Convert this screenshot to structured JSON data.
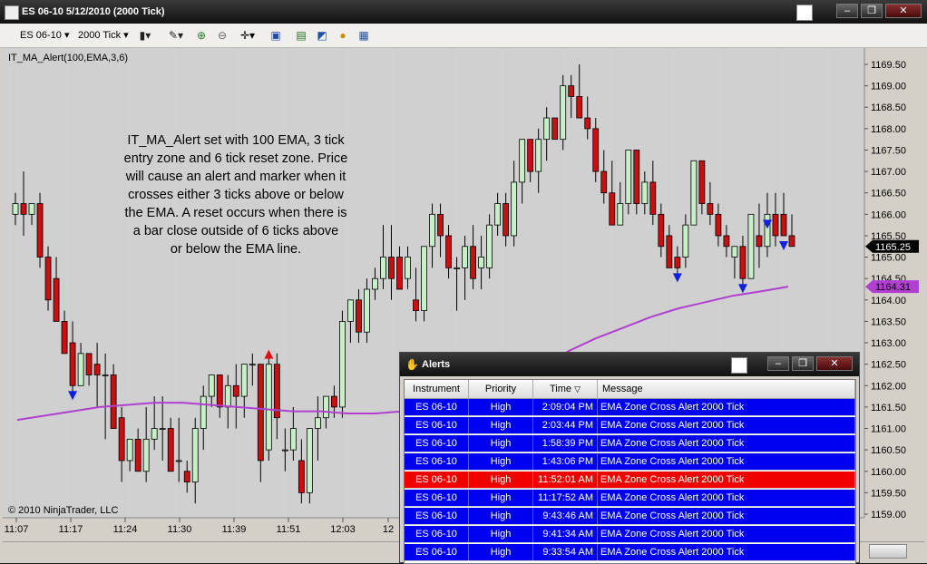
{
  "window": {
    "title": "ES 06-10  5/12/2010 (2000 Tick)",
    "l_button": "L",
    "controls": [
      "minimize-icon",
      "restore-icon",
      "close-icon"
    ]
  },
  "toolbar": {
    "instrument": "ES 06-10",
    "period": "2000 Tick",
    "icons": [
      "bar-chart-icon",
      "pencil-icon",
      "zoom-in-icon",
      "zoom-out-icon",
      "crosshair-icon",
      "properties-icon",
      "data-box-icon",
      "strategy-icon",
      "money-icon",
      "notes-icon"
    ]
  },
  "chart": {
    "indicator_label": "IT_MA_Alert(100,EMA,3,6)",
    "note_lines": [
      "IT_MA_Alert set with 100 EMA, 3 tick",
      "entry zone and 6 tick reset zone. Price",
      "will cause an alert and marker when it",
      "crosses either 3 ticks above or below",
      "the EMA. A reset occurs when there is",
      "a bar close outside of 6 ticks above",
      "or below the EMA line."
    ],
    "copyright": "© 2010 NinjaTrader, LLC",
    "last_price": "1165.25",
    "ema_value": "1164.31",
    "colors": {
      "up": "#c8f0c8",
      "down": "#c81010",
      "ema": "#b040d0",
      "marker_down": "#1020e0",
      "marker_up": "#e01010",
      "bg": "#d4d0c8"
    }
  },
  "chart_data": {
    "type": "candlestick",
    "y_ticks": [
      "1169.50",
      "1169.00",
      "1168.50",
      "1168.00",
      "1167.50",
      "1167.00",
      "1166.50",
      "1166.00",
      "1165.50",
      "1165.00",
      "1164.50",
      "1164.00",
      "1163.50",
      "1163.00",
      "1162.50",
      "1162.00",
      "1161.50",
      "1161.00",
      "1160.50",
      "1160.00",
      "1159.50",
      "1159.00"
    ],
    "ylim": [
      1158.75,
      1169.75
    ],
    "x_ticks": [
      "11:07",
      "11:17",
      "11:24",
      "11:30",
      "11:39",
      "11:51",
      "12:03",
      "12"
    ],
    "candles": [
      {
        "o": 1166.0,
        "h": 1166.5,
        "l": 1165.75,
        "c": 1166.25
      },
      {
        "o": 1166.25,
        "h": 1167.0,
        "l": 1165.5,
        "c": 1166.0
      },
      {
        "o": 1166.0,
        "h": 1166.25,
        "l": 1165.75,
        "c": 1166.25
      },
      {
        "o": 1166.25,
        "h": 1166.5,
        "l": 1164.75,
        "c": 1165.0
      },
      {
        "o": 1165.0,
        "h": 1165.25,
        "l": 1163.75,
        "c": 1164.0
      },
      {
        "o": 1164.5,
        "h": 1165.0,
        "l": 1163.5,
        "c": 1163.5
      },
      {
        "o": 1163.5,
        "h": 1163.75,
        "l": 1162.75,
        "c": 1162.75
      },
      {
        "o": 1163.0,
        "h": 1163.5,
        "l": 1161.75,
        "c": 1162.0
      },
      {
        "o": 1162.0,
        "h": 1163.0,
        "l": 1162.0,
        "c": 1162.75
      },
      {
        "o": 1162.75,
        "h": 1162.75,
        "l": 1162.0,
        "c": 1162.25
      },
      {
        "o": 1162.5,
        "h": 1163.0,
        "l": 1161.5,
        "c": 1162.25
      },
      {
        "o": 1162.25,
        "h": 1162.75,
        "l": 1160.75,
        "c": 1162.25
      },
      {
        "o": 1162.25,
        "h": 1162.5,
        "l": 1161.0,
        "c": 1161.0
      },
      {
        "o": 1161.25,
        "h": 1161.5,
        "l": 1159.75,
        "c": 1160.25
      },
      {
        "o": 1160.25,
        "h": 1160.75,
        "l": 1160.0,
        "c": 1160.75
      },
      {
        "o": 1160.75,
        "h": 1161.0,
        "l": 1160.0,
        "c": 1160.0
      },
      {
        "o": 1160.0,
        "h": 1161.5,
        "l": 1159.75,
        "c": 1160.75
      },
      {
        "o": 1160.75,
        "h": 1161.75,
        "l": 1160.5,
        "c": 1161.0
      },
      {
        "o": 1161.0,
        "h": 1161.75,
        "l": 1160.25,
        "c": 1161.0
      },
      {
        "o": 1161.0,
        "h": 1161.25,
        "l": 1160.0,
        "c": 1160.0
      },
      {
        "o": 1160.25,
        "h": 1161.25,
        "l": 1159.75,
        "c": 1160.25
      },
      {
        "o": 1160.0,
        "h": 1160.25,
        "l": 1159.5,
        "c": 1159.75
      },
      {
        "o": 1159.75,
        "h": 1161.25,
        "l": 1159.25,
        "c": 1161.0
      },
      {
        "o": 1161.0,
        "h": 1162.0,
        "l": 1160.5,
        "c": 1161.75
      },
      {
        "o": 1161.75,
        "h": 1162.25,
        "l": 1161.5,
        "c": 1162.25
      },
      {
        "o": 1162.25,
        "h": 1162.25,
        "l": 1161.25,
        "c": 1161.5
      },
      {
        "o": 1161.5,
        "h": 1162.25,
        "l": 1161.0,
        "c": 1162.0
      },
      {
        "o": 1162.0,
        "h": 1162.5,
        "l": 1161.0,
        "c": 1161.75
      },
      {
        "o": 1161.75,
        "h": 1162.5,
        "l": 1161.25,
        "c": 1162.5
      },
      {
        "o": 1162.5,
        "h": 1162.75,
        "l": 1162.0,
        "c": 1162.5
      },
      {
        "o": 1162.5,
        "h": 1162.5,
        "l": 1159.75,
        "c": 1160.25
      },
      {
        "o": 1160.5,
        "h": 1162.75,
        "l": 1160.25,
        "c": 1162.5
      },
      {
        "o": 1162.5,
        "h": 1162.75,
        "l": 1160.75,
        "c": 1161.25
      },
      {
        "o": 1160.5,
        "h": 1161.0,
        "l": 1160.0,
        "c": 1160.5
      },
      {
        "o": 1160.5,
        "h": 1161.5,
        "l": 1160.25,
        "c": 1161.0
      },
      {
        "o": 1160.25,
        "h": 1160.75,
        "l": 1159.25,
        "c": 1159.5
      },
      {
        "o": 1159.5,
        "h": 1161.0,
        "l": 1159.25,
        "c": 1161.0
      },
      {
        "o": 1161.0,
        "h": 1161.75,
        "l": 1160.25,
        "c": 1161.25
      },
      {
        "o": 1161.25,
        "h": 1161.75,
        "l": 1161.0,
        "c": 1161.75
      },
      {
        "o": 1161.75,
        "h": 1162.0,
        "l": 1161.25,
        "c": 1161.5
      },
      {
        "o": 1161.5,
        "h": 1163.75,
        "l": 1161.25,
        "c": 1163.5
      },
      {
        "o": 1163.5,
        "h": 1164.0,
        "l": 1163.0,
        "c": 1164.0
      },
      {
        "o": 1164.0,
        "h": 1164.25,
        "l": 1163.0,
        "c": 1163.25
      },
      {
        "o": 1163.25,
        "h": 1164.5,
        "l": 1163.0,
        "c": 1164.25
      },
      {
        "o": 1164.25,
        "h": 1164.75,
        "l": 1164.0,
        "c": 1164.5
      },
      {
        "o": 1164.5,
        "h": 1165.75,
        "l": 1164.25,
        "c": 1165.0
      },
      {
        "o": 1165.0,
        "h": 1165.75,
        "l": 1164.0,
        "c": 1164.5
      },
      {
        "o": 1165.0,
        "h": 1165.25,
        "l": 1164.25,
        "c": 1164.25
      },
      {
        "o": 1164.5,
        "h": 1165.25,
        "l": 1164.25,
        "c": 1165.0
      },
      {
        "o": 1164.0,
        "h": 1164.75,
        "l": 1163.5,
        "c": 1163.75
      },
      {
        "o": 1163.75,
        "h": 1165.25,
        "l": 1163.5,
        "c": 1165.25
      },
      {
        "o": 1165.25,
        "h": 1166.25,
        "l": 1164.75,
        "c": 1166.0
      },
      {
        "o": 1166.0,
        "h": 1166.25,
        "l": 1165.0,
        "c": 1165.5
      },
      {
        "o": 1165.5,
        "h": 1165.75,
        "l": 1164.5,
        "c": 1164.75
      },
      {
        "o": 1164.75,
        "h": 1165.0,
        "l": 1163.75,
        "c": 1164.75
      },
      {
        "o": 1164.75,
        "h": 1165.5,
        "l": 1164.0,
        "c": 1165.25
      },
      {
        "o": 1165.25,
        "h": 1165.75,
        "l": 1164.25,
        "c": 1164.5
      },
      {
        "o": 1164.75,
        "h": 1165.5,
        "l": 1164.25,
        "c": 1165.0
      },
      {
        "o": 1164.75,
        "h": 1166.0,
        "l": 1164.5,
        "c": 1165.75
      },
      {
        "o": 1165.75,
        "h": 1166.5,
        "l": 1165.5,
        "c": 1166.25
      },
      {
        "o": 1166.25,
        "h": 1166.5,
        "l": 1165.25,
        "c": 1165.5
      },
      {
        "o": 1165.5,
        "h": 1167.25,
        "l": 1165.25,
        "c": 1166.75
      },
      {
        "o": 1166.75,
        "h": 1167.75,
        "l": 1166.25,
        "c": 1167.75
      },
      {
        "o": 1167.75,
        "h": 1167.75,
        "l": 1166.75,
        "c": 1167.0
      },
      {
        "o": 1167.0,
        "h": 1168.0,
        "l": 1166.5,
        "c": 1167.75
      },
      {
        "o": 1167.75,
        "h": 1168.5,
        "l": 1167.25,
        "c": 1168.25
      },
      {
        "o": 1168.25,
        "h": 1168.25,
        "l": 1167.75,
        "c": 1167.75
      },
      {
        "o": 1167.75,
        "h": 1169.25,
        "l": 1167.5,
        "c": 1169.0
      },
      {
        "o": 1169.0,
        "h": 1169.25,
        "l": 1168.25,
        "c": 1168.75
      },
      {
        "o": 1168.75,
        "h": 1169.5,
        "l": 1168.25,
        "c": 1168.25
      },
      {
        "o": 1168.25,
        "h": 1168.75,
        "l": 1167.75,
        "c": 1168.0
      },
      {
        "o": 1168.0,
        "h": 1168.25,
        "l": 1166.75,
        "c": 1167.0
      },
      {
        "o": 1167.0,
        "h": 1167.5,
        "l": 1166.25,
        "c": 1166.5
      },
      {
        "o": 1166.5,
        "h": 1167.25,
        "l": 1165.75,
        "c": 1165.75
      },
      {
        "o": 1165.75,
        "h": 1166.75,
        "l": 1165.75,
        "c": 1166.25
      },
      {
        "o": 1166.25,
        "h": 1167.5,
        "l": 1166.0,
        "c": 1167.5
      },
      {
        "o": 1167.5,
        "h": 1167.5,
        "l": 1166.0,
        "c": 1166.25
      },
      {
        "o": 1166.25,
        "h": 1167.0,
        "l": 1166.0,
        "c": 1166.75
      },
      {
        "o": 1166.75,
        "h": 1167.25,
        "l": 1165.75,
        "c": 1166.0
      },
      {
        "o": 1166.0,
        "h": 1166.25,
        "l": 1165.0,
        "c": 1165.25
      },
      {
        "o": 1165.5,
        "h": 1165.75,
        "l": 1164.75,
        "c": 1164.75
      },
      {
        "o": 1165.0,
        "h": 1165.25,
        "l": 1164.5,
        "c": 1164.75
      },
      {
        "o": 1165.0,
        "h": 1166.0,
        "l": 1164.75,
        "c": 1165.75
      },
      {
        "o": 1165.75,
        "h": 1167.25,
        "l": 1165.75,
        "c": 1167.25
      },
      {
        "o": 1167.25,
        "h": 1167.25,
        "l": 1166.0,
        "c": 1166.25
      },
      {
        "o": 1166.25,
        "h": 1166.75,
        "l": 1165.75,
        "c": 1166.0
      },
      {
        "o": 1166.0,
        "h": 1166.25,
        "l": 1165.25,
        "c": 1165.5
      },
      {
        "o": 1165.5,
        "h": 1165.75,
        "l": 1165.0,
        "c": 1165.25
      },
      {
        "o": 1165.0,
        "h": 1165.25,
        "l": 1164.5,
        "c": 1165.25
      },
      {
        "o": 1165.25,
        "h": 1165.5,
        "l": 1164.25,
        "c": 1164.5
      },
      {
        "o": 1164.5,
        "h": 1166.0,
        "l": 1164.5,
        "c": 1166.0
      },
      {
        "o": 1165.5,
        "h": 1166.25,
        "l": 1164.75,
        "c": 1165.25
      },
      {
        "o": 1165.25,
        "h": 1166.5,
        "l": 1165.0,
        "c": 1166.0
      },
      {
        "o": 1166.0,
        "h": 1166.5,
        "l": 1165.25,
        "c": 1165.5
      },
      {
        "o": 1166.0,
        "h": 1166.5,
        "l": 1165.5,
        "c": 1165.5
      },
      {
        "o": 1165.5,
        "h": 1166.0,
        "l": 1165.25,
        "c": 1165.25
      }
    ],
    "ema": [
      1161.2,
      1161.3,
      1161.4,
      1161.5,
      1161.55,
      1161.6,
      1161.6,
      1161.55,
      1161.5,
      1161.45,
      1161.4,
      1161.4,
      1161.35,
      1161.35,
      1161.4,
      1161.5,
      1161.6,
      1161.8,
      1162.1,
      1162.4,
      1162.8,
      1163.1,
      1163.35,
      1163.6,
      1163.8,
      1163.95,
      1164.1,
      1164.2,
      1164.31
    ],
    "alerts_down_bar_index": [
      7,
      81,
      89,
      92,
      94
    ],
    "alerts_up_bar_index": [
      31
    ]
  },
  "alerts": {
    "title": "Alerts",
    "l_button": "L",
    "columns": [
      "Instrument",
      "Priority",
      "Time",
      "Message"
    ],
    "rows": [
      {
        "instrument": "ES 06-10",
        "priority": "High",
        "time": "2:09:04 PM",
        "message": "EMA Zone Cross Alert 2000 Tick",
        "color": "#0000f0"
      },
      {
        "instrument": "ES 06-10",
        "priority": "High",
        "time": "2:03:44 PM",
        "message": "EMA Zone Cross Alert 2000 Tick",
        "color": "#0000f0"
      },
      {
        "instrument": "ES 06-10",
        "priority": "High",
        "time": "1:58:39 PM",
        "message": "EMA Zone Cross Alert 2000 Tick",
        "color": "#0000f0"
      },
      {
        "instrument": "ES 06-10",
        "priority": "High",
        "time": "1:43:06 PM",
        "message": "EMA Zone Cross Alert 2000 Tick",
        "color": "#0000f0"
      },
      {
        "instrument": "ES 06-10",
        "priority": "High",
        "time": "11:52:01 AM",
        "message": "EMA Zone Cross Alert 2000 Tick",
        "color": "#f00000"
      },
      {
        "instrument": "ES 06-10",
        "priority": "High",
        "time": "11:17:52 AM",
        "message": "EMA Zone Cross Alert 2000 Tick",
        "color": "#0000f0"
      },
      {
        "instrument": "ES 06-10",
        "priority": "High",
        "time": "9:43:46 AM",
        "message": "EMA Zone Cross Alert 2000 Tick",
        "color": "#0000f0"
      },
      {
        "instrument": "ES 06-10",
        "priority": "High",
        "time": "9:41:34 AM",
        "message": "EMA Zone Cross Alert 2000 Tick",
        "color": "#0000f0"
      },
      {
        "instrument": "ES 06-10",
        "priority": "High",
        "time": "9:33:54 AM",
        "message": "EMA Zone Cross Alert 2000 Tick",
        "color": "#0000f0"
      }
    ]
  }
}
